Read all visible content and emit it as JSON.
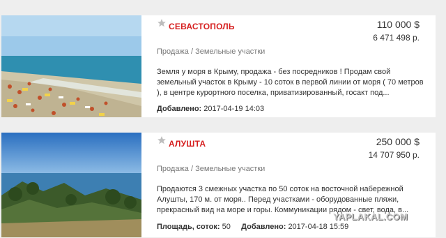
{
  "listings": [
    {
      "city": "СЕВАСТОПОЛЬ",
      "price_usd": "110 000 $",
      "price_rub": "6 471 498 р.",
      "category": "Продажа / Земельные участки",
      "description": "Земля у моря в Крыму, продажа - без посредников ! Продам свой земельный участок в Крыму - 10 соток в первой линии от моря ( 70 метров ), в центре курортного поселка, приватизированный, госакт под...",
      "added_label": "Добавлено:",
      "added_value": "2017-04-19 14:03",
      "thumbnail": "beach-photo"
    },
    {
      "city": "АЛУШТА",
      "price_usd": "250 000 $",
      "price_rub": "14 707 950 р.",
      "category": "Продажа / Земельные участки",
      "description": "Продаются 3 смежных участка по 50 соток на восточной набережной Алушты, 170 м. от моря.. Перед участками - оборудованные пляжи, прекрасный вид на море и горы. Коммуникации рядом - свет, вода, в...",
      "area_label": "Площадь, соток:",
      "area_value": "50",
      "added_label": "Добавлено:",
      "added_value": "2017-04-18 15:59",
      "thumbnail": "sea-hillside-photo"
    }
  ],
  "icons": {
    "favorite": "star-icon"
  },
  "colors": {
    "city": "#d62020",
    "background": "#eeeeee",
    "card": "#ffffff"
  },
  "watermark": "YAPLAKAL.COM"
}
